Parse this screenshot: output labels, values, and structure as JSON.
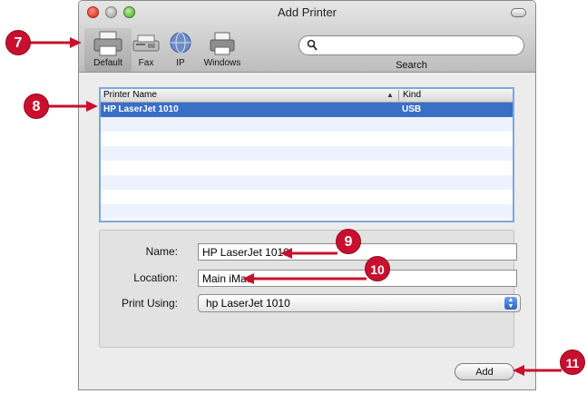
{
  "window": {
    "title": "Add Printer"
  },
  "toolbar": {
    "buttons": [
      {
        "label": "Default",
        "icon": "default-printer-icon"
      },
      {
        "label": "Fax",
        "icon": "fax-icon"
      },
      {
        "label": "IP",
        "icon": "globe-icon"
      },
      {
        "label": "Windows",
        "icon": "windows-printer-icon"
      }
    ],
    "search": {
      "placeholder": "",
      "label": "Search"
    }
  },
  "printer_list": {
    "columns": [
      "Printer Name",
      "Kind"
    ],
    "rows": [
      {
        "name": "HP LaserJet 1010",
        "kind": "USB",
        "selected": true
      }
    ]
  },
  "form": {
    "name_label": "Name:",
    "name_value": "HP LaserJet 1010",
    "location_label": "Location:",
    "location_value": "Main iMac",
    "print_using_label": "Print Using:",
    "print_using_value": "hp LaserJet 1010"
  },
  "add_button": "Add",
  "callouts": [
    "7",
    "8",
    "9",
    "10",
    "11"
  ],
  "colors": {
    "callout": "#c8102e",
    "selection": "#3a6fc8"
  }
}
